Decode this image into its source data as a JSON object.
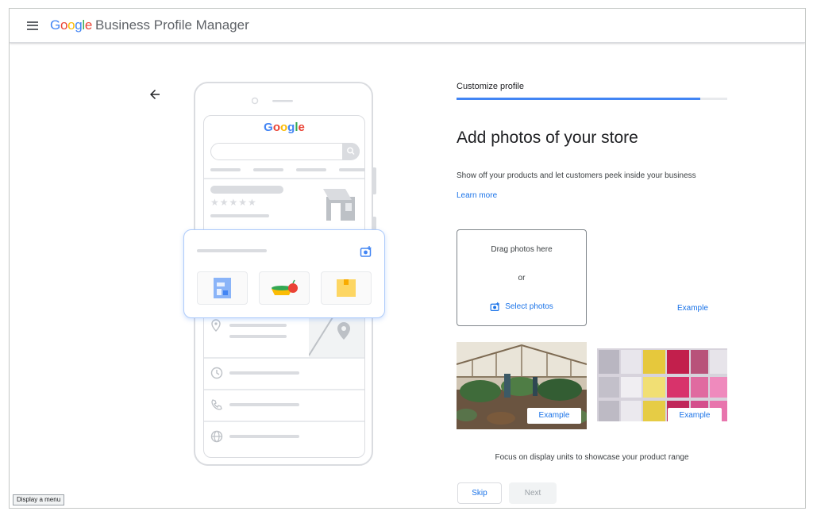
{
  "header": {
    "logo_parts": [
      "G",
      "o",
      "o",
      "g",
      "l",
      "e"
    ],
    "title": "Business Profile Manager",
    "menu_icon": "hamburger-menu-icon"
  },
  "nav": {
    "back_icon": "arrow-back-icon"
  },
  "illustration": {
    "logo_parts": [
      "G",
      "o",
      "o",
      "g",
      "l",
      "e"
    ],
    "stars": "★★★★★"
  },
  "step": {
    "label": "Customize profile",
    "progress": 0.9
  },
  "main": {
    "title": "Add photos of your store",
    "subtitle": "Show off your products and let customers peek inside your business",
    "learn_more": "Learn more"
  },
  "upload": {
    "drag_text": "Drag photos here",
    "or_text": "or",
    "select_label": "Select photos"
  },
  "examples": {
    "link_label": "Example",
    "photo1_label": "Example",
    "photo2_label": "Example",
    "caption": "Focus on display units to showcase your product range"
  },
  "actions": {
    "skip_label": "Skip",
    "next_label": "Next"
  },
  "tooltip": "Display a menu",
  "colors": {
    "accent": "#1a73e8",
    "progress": "#4285f4",
    "border": "#dadce0"
  }
}
